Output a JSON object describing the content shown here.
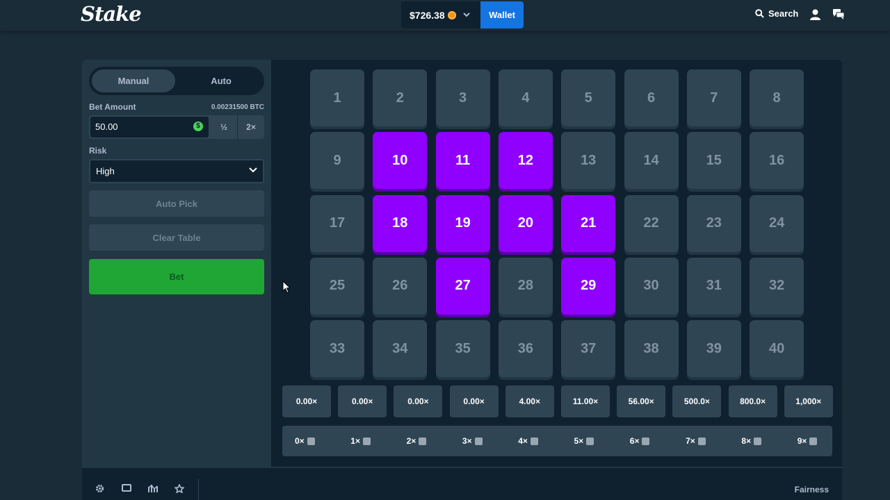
{
  "header": {
    "logo": "Stake",
    "balance": "$726.38",
    "wallet_label": "Wallet",
    "search_label": "Search",
    "coin_color": "#f7931a"
  },
  "sidebar": {
    "mode_manual": "Manual",
    "mode_auto": "Auto",
    "active_mode": "Manual",
    "bet_amount_label": "Bet Amount",
    "bet_amount_btc": "0.00231500 BTC",
    "bet_amount_value": "50.00",
    "half_label": "½",
    "double_label": "2×",
    "risk_label": "Risk",
    "risk_value": "High",
    "auto_pick_label": "Auto Pick",
    "clear_table_label": "Clear Table",
    "bet_label": "Bet"
  },
  "board": {
    "tiles": [
      "1",
      "2",
      "3",
      "4",
      "5",
      "6",
      "7",
      "8",
      "9",
      "10",
      "11",
      "12",
      "13",
      "14",
      "15",
      "16",
      "17",
      "18",
      "19",
      "20",
      "21",
      "22",
      "23",
      "24",
      "25",
      "26",
      "27",
      "28",
      "29",
      "30",
      "31",
      "32",
      "33",
      "34",
      "35",
      "36",
      "37",
      "38",
      "39",
      "40"
    ],
    "selected": [
      "10",
      "11",
      "12",
      "18",
      "19",
      "20",
      "21",
      "27",
      "29"
    ],
    "selected_color": "#9000ff"
  },
  "payouts": {
    "multipliers": [
      "0.00×",
      "0.00×",
      "0.00×",
      "0.00×",
      "4.00×",
      "11.00×",
      "56.00×",
      "500.0×",
      "800.0×",
      "1,000×"
    ],
    "hits": [
      "0×",
      "1×",
      "2×",
      "3×",
      "4×",
      "5×",
      "6×",
      "7×",
      "8×",
      "9×"
    ]
  },
  "footer": {
    "fairness_label": "Fairness",
    "icons": [
      "gear-icon",
      "theatre-mode-icon",
      "stats-icon",
      "favorite-star-icon"
    ]
  },
  "colors": {
    "bg": "#1a2c38",
    "panel": "#213743",
    "dark": "#0f212e",
    "tile": "#2f4553",
    "bet_button": "#1fa635",
    "wallet_button": "#1475e1"
  }
}
